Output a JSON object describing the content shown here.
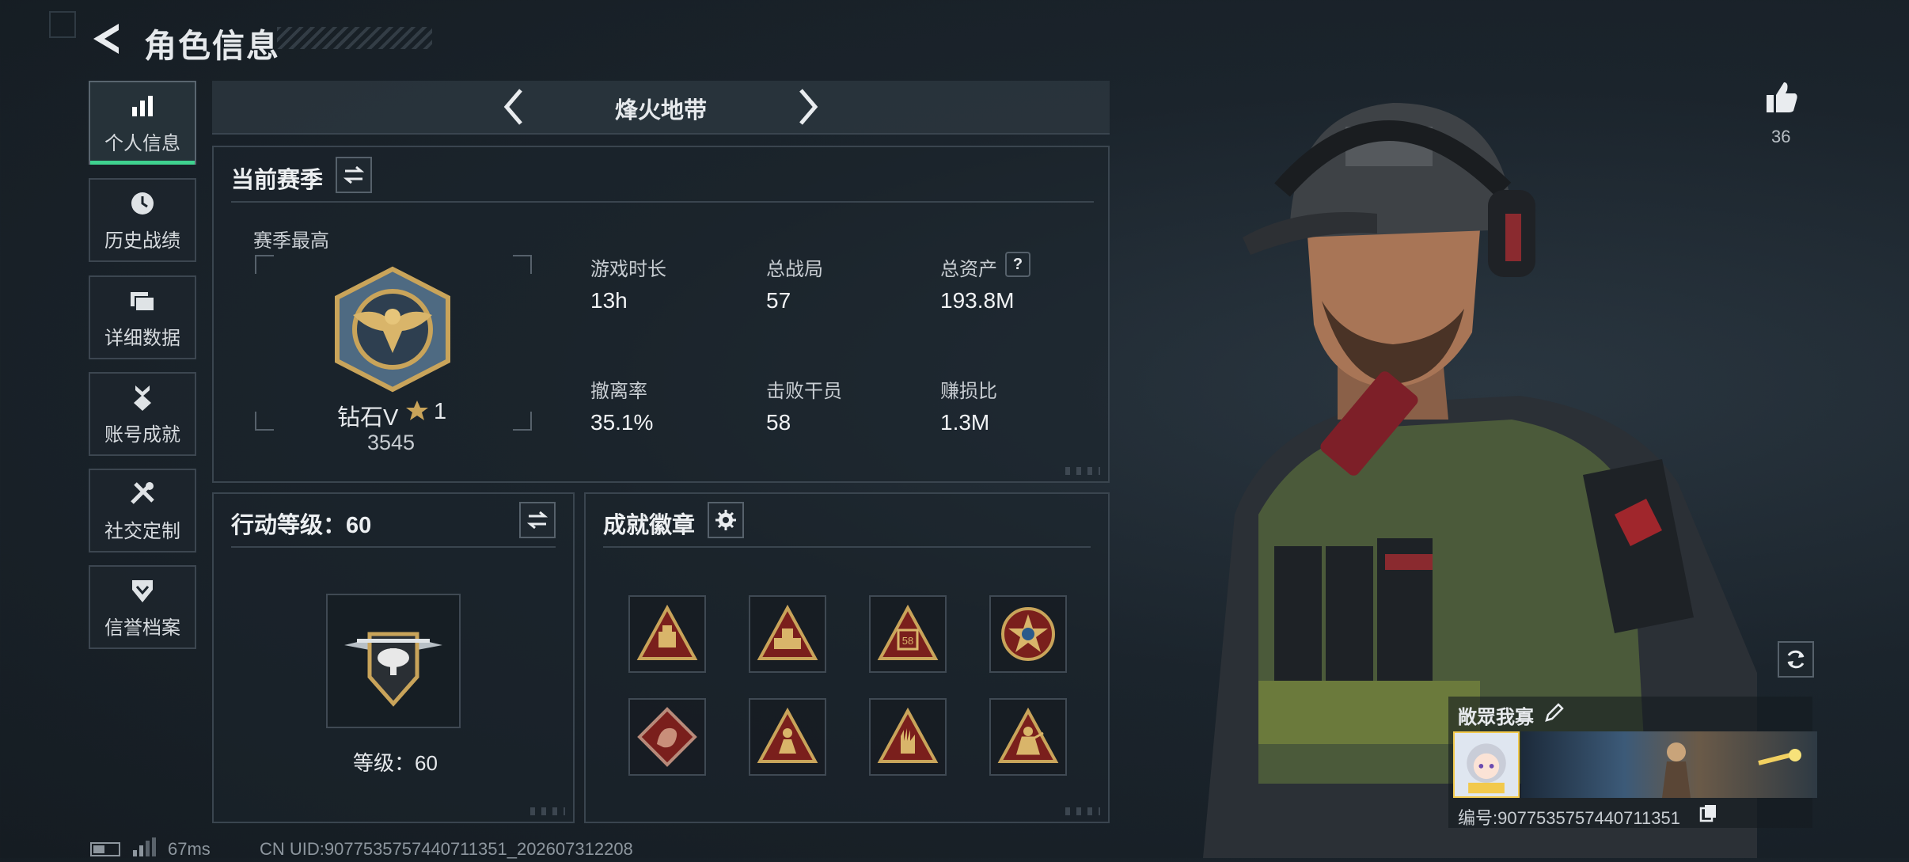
{
  "header": {
    "title": "角色信息"
  },
  "sidebar": {
    "items": [
      {
        "label": "个人信息",
        "icon": "bar-chart-icon",
        "active": true
      },
      {
        "label": "历史战绩",
        "icon": "clock-history-icon"
      },
      {
        "label": "详细数据",
        "icon": "folders-icon"
      },
      {
        "label": "账号成就",
        "icon": "medal-icon"
      },
      {
        "label": "社交定制",
        "icon": "tools-icon"
      },
      {
        "label": "信誉档案",
        "icon": "shield-chevron-icon"
      }
    ]
  },
  "mode": {
    "name": "烽火地带"
  },
  "season": {
    "title": "当前赛季",
    "best_label": "赛季最高",
    "rank_name": "钻石V",
    "rank_stars": "1",
    "rank_points": "3545",
    "stats": [
      {
        "label": "游戏时长",
        "value": "13h"
      },
      {
        "label": "总战局",
        "value": "57"
      },
      {
        "label": "总资产",
        "value": "193.8M"
      },
      {
        "label": "撤离率",
        "value": "35.1%"
      },
      {
        "label": "击败干员",
        "value": "58"
      },
      {
        "label": "赚损比",
        "value": "1.3M"
      }
    ],
    "help_icon": "?"
  },
  "action_level": {
    "title": "行动等级：60",
    "level_text": "等级：60"
  },
  "achievements": {
    "title": "成就徽章",
    "badges": [
      "triangle-crate-badge",
      "triangle-vehicle-badge",
      "triangle-58-badge",
      "round-star-badge",
      "diamond-dragon-badge",
      "triangle-person-badge",
      "triangle-hand-badge",
      "triangle-soldier-badge"
    ],
    "badge_number": "58"
  },
  "likes": {
    "count": "36"
  },
  "profile_card": {
    "name": "敞眾我寡",
    "id_text": "编号:9077535757440711351"
  },
  "footer": {
    "ping": "67ms",
    "uid": "CN UID:9077535757440711351_202607312208"
  },
  "colors": {
    "accent": "#3fd28f",
    "gold": "#c9a45a",
    "badge_red": "#7a1f1c"
  }
}
